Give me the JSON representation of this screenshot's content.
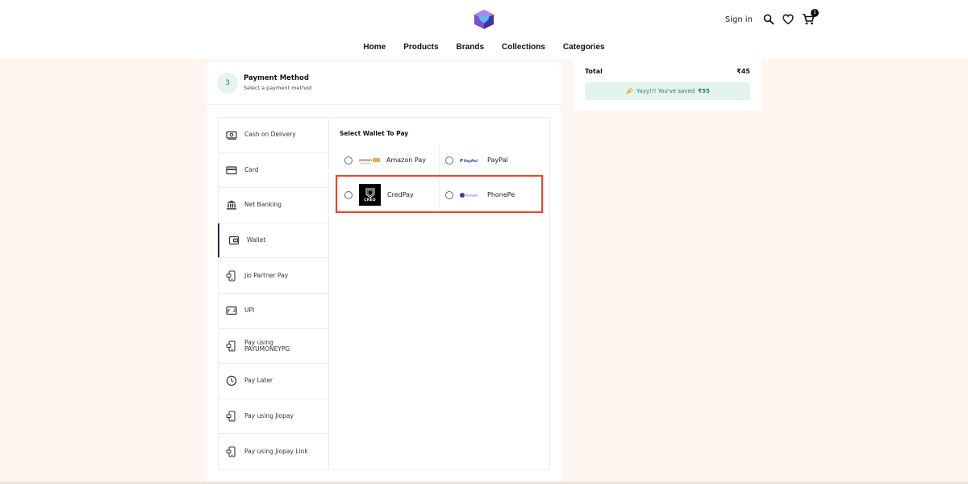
{
  "header": {
    "signin": "Sign in",
    "cart_count": "1",
    "nav": [
      "Home",
      "Products",
      "Brands",
      "Collections",
      "Categories"
    ]
  },
  "payment": {
    "step": "3",
    "title": "Payment Method",
    "subtitle": "Select a payment method",
    "methods": [
      {
        "label": "Cash on Delivery",
        "icon": "cash-icon"
      },
      {
        "label": "Card",
        "icon": "card-icon"
      },
      {
        "label": "Net Banking",
        "icon": "bank-icon"
      },
      {
        "label": "Wallet",
        "icon": "wallet-icon"
      },
      {
        "label": "Jio Partner Pay",
        "icon": "phone-pay-icon"
      },
      {
        "label": "UPI",
        "icon": "upi-icon"
      },
      {
        "label": "Pay using PAYUMONEYPG",
        "icon": "phone-pay-icon"
      },
      {
        "label": "Pay Later",
        "icon": "clock-icon"
      },
      {
        "label": "Pay using Jiopay",
        "icon": "phone-pay-icon"
      },
      {
        "label": "Pay using Jiopay Link",
        "icon": "phone-pay-icon"
      }
    ],
    "wallet_title": "Select Wallet To Pay",
    "wallets": [
      {
        "name": "Amazon Pay",
        "logo_text": "amazon pay"
      },
      {
        "name": "PayPal",
        "logo_text": "PayPal"
      },
      {
        "name": "CredPay",
        "logo_text": "CRED"
      },
      {
        "name": "PhonePe",
        "logo_text": "PhonePe"
      }
    ]
  },
  "summary": {
    "total_label": "Total",
    "total_value": "₹45",
    "saved_text": "Yayy!!! You've saved",
    "saved_amount": "₹55"
  },
  "colors": {
    "accent_highlight": "#e8462b",
    "active_bar": "#1d2a44",
    "saved_bg": "#e3f3ee",
    "page_bg": "#fdf6f0"
  }
}
